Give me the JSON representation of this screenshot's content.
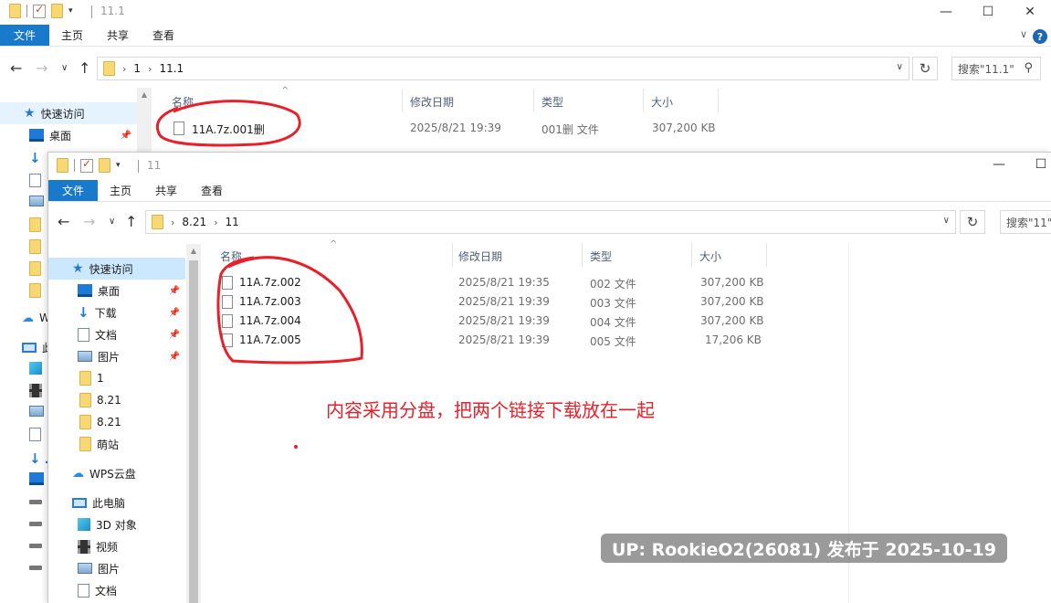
{
  "back_window": {
    "title": "11.1",
    "ribbon_tabs": [
      "文件",
      "主页",
      "共享",
      "查看"
    ],
    "breadcrumb": [
      "1",
      "11.1"
    ],
    "search_placeholder": "搜索\"11.1\"",
    "sidebar": {
      "quick_access": "快速访问",
      "items": [
        "桌面"
      ],
      "wps_cloud": "W",
      "this_pc": "此"
    },
    "columns": [
      "名称",
      "修改日期",
      "类型",
      "大小"
    ],
    "files": [
      {
        "name": "11A.7z.001删",
        "modified": "2025/8/21 19:39",
        "type": "001删 文件",
        "size": "307,200 KB"
      }
    ]
  },
  "front_window": {
    "title": "11",
    "ribbon_tabs": [
      "文件",
      "主页",
      "共享",
      "查看"
    ],
    "breadcrumb": [
      "8.21",
      "11"
    ],
    "search_placeholder": "搜索\"11\"",
    "sidebar": {
      "quick_access": "快速访问",
      "items": [
        "桌面",
        "下载",
        "文档",
        "图片",
        "1",
        "8.21",
        "8.21",
        "萌站"
      ],
      "wps_cloud": "WPS云盘",
      "this_pc": "此电脑",
      "pc_items": [
        "3D 对象",
        "视频",
        "图片",
        "文档"
      ]
    },
    "columns": [
      "名称",
      "修改日期",
      "类型",
      "大小"
    ],
    "files": [
      {
        "name": "11A.7z.002",
        "modified": "2025/8/21 19:35",
        "type": "002 文件",
        "size": "307,200 KB"
      },
      {
        "name": "11A.7z.003",
        "modified": "2025/8/21 19:39",
        "type": "003 文件",
        "size": "307,200 KB"
      },
      {
        "name": "11A.7z.004",
        "modified": "2025/8/21 19:39",
        "type": "004 文件",
        "size": "307,200 KB"
      },
      {
        "name": "11A.7z.005",
        "modified": "2025/8/21 19:39",
        "type": "005 文件",
        "size": "17,206 KB"
      }
    ]
  },
  "annotation_text": "内容采用分盘，把两个链接下载放在一起",
  "watermark": "UP: RookieO2(26081) 发布于 2025-10-19",
  "colors": {
    "accent": "#1979ca",
    "annotation_red": "#e8202a",
    "selection": "#cce8ff"
  }
}
